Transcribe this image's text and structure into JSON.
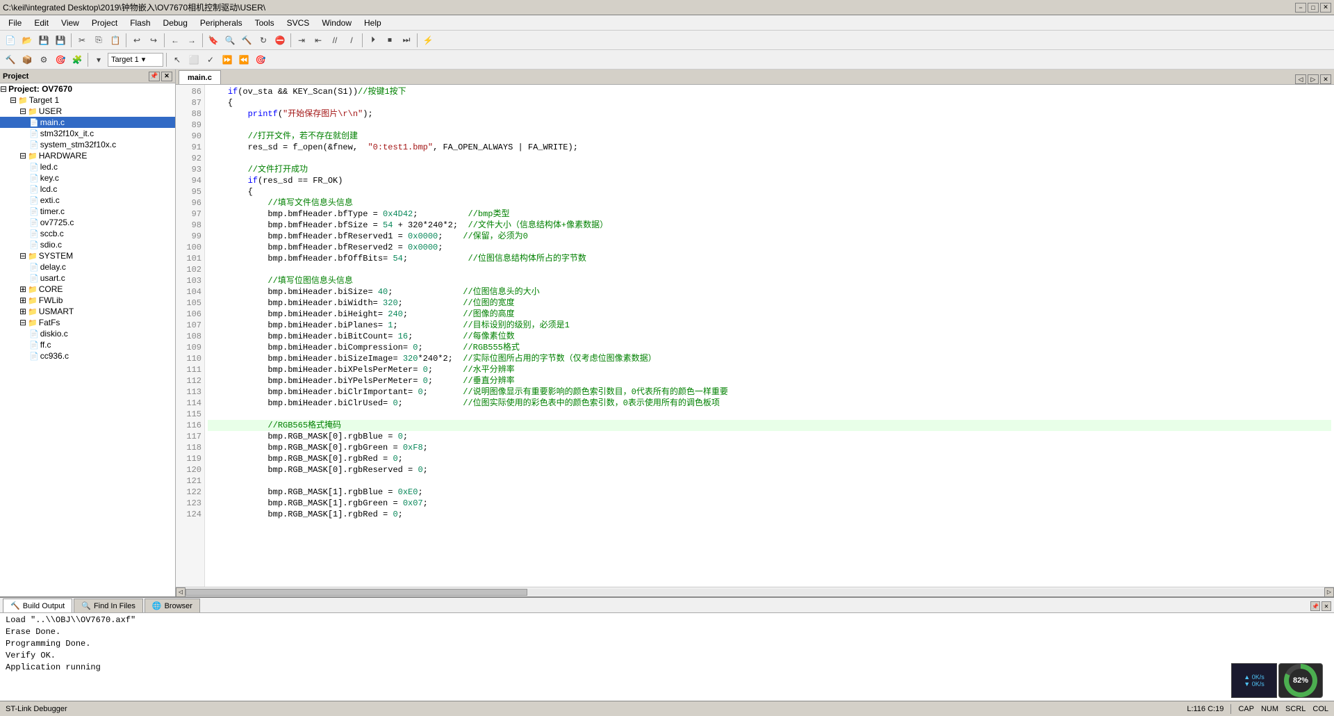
{
  "title_bar": {
    "text": "C:\\keil\\integrated Desktop\\2019\\钟物嵌入\\OV7670相机控制驱动\\USER\\",
    "minimize": "−",
    "maximize": "□",
    "close": "✕"
  },
  "menu": {
    "items": [
      "File",
      "Edit",
      "View",
      "Project",
      "Flash",
      "Debug",
      "Peripherals",
      "Tools",
      "SVCS",
      "Window",
      "Help"
    ]
  },
  "toolbar": {
    "target_dropdown": "Target 1"
  },
  "project_panel": {
    "title": "Project",
    "tree": [
      {
        "label": "Project: OV7670",
        "indent": 0,
        "type": "root",
        "expanded": true
      },
      {
        "label": "Target 1",
        "indent": 1,
        "type": "folder",
        "expanded": true
      },
      {
        "label": "USER",
        "indent": 2,
        "type": "folder",
        "expanded": true
      },
      {
        "label": "main.c",
        "indent": 3,
        "type": "file"
      },
      {
        "label": "stm32f10x_it.c",
        "indent": 3,
        "type": "file"
      },
      {
        "label": "system_stm32f10x.c",
        "indent": 3,
        "type": "file"
      },
      {
        "label": "HARDWARE",
        "indent": 2,
        "type": "folder",
        "expanded": true
      },
      {
        "label": "led.c",
        "indent": 3,
        "type": "file"
      },
      {
        "label": "key.c",
        "indent": 3,
        "type": "file"
      },
      {
        "label": "lcd.c",
        "indent": 3,
        "type": "file"
      },
      {
        "label": "exti.c",
        "indent": 3,
        "type": "file"
      },
      {
        "label": "timer.c",
        "indent": 3,
        "type": "file"
      },
      {
        "label": "ov7725.c",
        "indent": 3,
        "type": "file"
      },
      {
        "label": "sccb.c",
        "indent": 3,
        "type": "file"
      },
      {
        "label": "sdio.c",
        "indent": 3,
        "type": "file"
      },
      {
        "label": "SYSTEM",
        "indent": 2,
        "type": "folder",
        "expanded": true
      },
      {
        "label": "delay.c",
        "indent": 3,
        "type": "file"
      },
      {
        "label": "usart.c",
        "indent": 3,
        "type": "file"
      },
      {
        "label": "CORE",
        "indent": 2,
        "type": "folder",
        "expanded": false
      },
      {
        "label": "FWLib",
        "indent": 2,
        "type": "folder",
        "expanded": false
      },
      {
        "label": "USMART",
        "indent": 2,
        "type": "folder",
        "expanded": false
      },
      {
        "label": "FatFs",
        "indent": 2,
        "type": "folder",
        "expanded": true
      },
      {
        "label": "diskio.c",
        "indent": 3,
        "type": "file"
      },
      {
        "label": "ff.c",
        "indent": 3,
        "type": "file"
      },
      {
        "label": "cc936.c",
        "indent": 3,
        "type": "file"
      }
    ]
  },
  "editor": {
    "active_tab": "main.c",
    "lines": [
      {
        "num": 86,
        "content": "    if(ov_sta && KEY_Scan(S1))//按键1按下",
        "highlight": false
      },
      {
        "num": 87,
        "content": "    {",
        "highlight": false
      },
      {
        "num": 88,
        "content": "        printf(\"开始保存图片\\r\\n\");",
        "highlight": false
      },
      {
        "num": 89,
        "content": "",
        "highlight": false
      },
      {
        "num": 90,
        "content": "        //打开文件，若不存在就创建",
        "highlight": false
      },
      {
        "num": 91,
        "content": "        res_sd = f_open(&fnew,  \"0:test1.bmp\", FA_OPEN_ALWAYS | FA_WRITE);",
        "highlight": false
      },
      {
        "num": 92,
        "content": "",
        "highlight": false
      },
      {
        "num": 93,
        "content": "        //文件打开成功",
        "highlight": false
      },
      {
        "num": 94,
        "content": "        if(res_sd == FR_OK)",
        "highlight": false
      },
      {
        "num": 95,
        "content": "        {",
        "highlight": false
      },
      {
        "num": 96,
        "content": "            //填写文件信息头信息",
        "highlight": false
      },
      {
        "num": 97,
        "content": "            bmp.bmfHeader.bfType = 0x4D42;          //bmp类型",
        "highlight": false
      },
      {
        "num": 98,
        "content": "            bmp.bmfHeader.bfSize = 54 + 320*240*2;  //文件大小（信息结构体+像素数据）",
        "highlight": false
      },
      {
        "num": 99,
        "content": "            bmp.bmfHeader.bfReserved1 = 0x0000;    //保留，必须为0",
        "highlight": false
      },
      {
        "num": 100,
        "content": "            bmp.bmfHeader.bfReserved2 = 0x0000;",
        "highlight": false
      },
      {
        "num": 101,
        "content": "            bmp.bmfHeader.bfOffBits=54;            //位图信息结构体所占的字节数",
        "highlight": false
      },
      {
        "num": 102,
        "content": "",
        "highlight": false
      },
      {
        "num": 103,
        "content": "            //填写位图信息头信息",
        "highlight": false
      },
      {
        "num": 104,
        "content": "            bmp.bmiHeader.biSize=40;              //位图信息头的大小",
        "highlight": false
      },
      {
        "num": 105,
        "content": "            bmp.bmiHeader.biWidth=320;            //位图的宽度",
        "highlight": false
      },
      {
        "num": 106,
        "content": "            bmp.bmiHeader.biHeight=240;           //图像的高度",
        "highlight": false
      },
      {
        "num": 107,
        "content": "            bmp.bmiHeader.biPlanes=1;             //目标设别的级别，必须是1",
        "highlight": false
      },
      {
        "num": 108,
        "content": "            bmp.bmiHeader.biBitCount=16;          //每像素位数",
        "highlight": false
      },
      {
        "num": 109,
        "content": "            bmp.bmiHeader.biCompression=0;        //RGB555格式",
        "highlight": false
      },
      {
        "num": 110,
        "content": "            bmp.bmiHeader.biSizeImage=320*240*2;  //实际位图所占用的字节数（仅考虑位图像素数据）",
        "highlight": false
      },
      {
        "num": 111,
        "content": "            bmp.bmiHeader.biXPelsPerMeter=0;      //水平分辨率",
        "highlight": false
      },
      {
        "num": 112,
        "content": "            bmp.bmiHeader.biYPelsPerMeter=0;      //垂直分辨率",
        "highlight": false
      },
      {
        "num": 113,
        "content": "            bmp.bmiHeader.biClrImportant=0;       //说明图像显示有重要影响的颜色索引数目，0代表所有的颜色一样重要",
        "highlight": false
      },
      {
        "num": 114,
        "content": "            bmp.bmiHeader.biClrUsed=0;            //位图实际使用的彩色表中的颜色索引数，0表示使用所有的调色板项",
        "highlight": false
      },
      {
        "num": 115,
        "content": "",
        "highlight": false
      },
      {
        "num": 116,
        "content": "            //RGB565格式掩码",
        "highlight": true
      },
      {
        "num": 117,
        "content": "            bmp.RGB_MASK[0].rgbBlue = 0;",
        "highlight": false
      },
      {
        "num": 118,
        "content": "            bmp.RGB_MASK[0].rgbGreen = 0xF8;",
        "highlight": false
      },
      {
        "num": 119,
        "content": "            bmp.RGB_MASK[0].rgbRed = 0;",
        "highlight": false
      },
      {
        "num": 120,
        "content": "            bmp.RGB_MASK[0].rgbReserved = 0;",
        "highlight": false
      },
      {
        "num": 121,
        "content": "",
        "highlight": false
      },
      {
        "num": 122,
        "content": "            bmp.RGB_MASK[1].rgbBlue = 0xE0;",
        "highlight": false
      },
      {
        "num": 123,
        "content": "            bmp.RGB_MASK[1].rgbGreen = 0x07;",
        "highlight": false
      },
      {
        "num": 124,
        "content": "            bmp.RGB_MASK[1].rgbRed = 0;",
        "highlight": false
      }
    ]
  },
  "build_output": {
    "tabs": [
      {
        "label": "Build Output",
        "icon": "build-icon",
        "active": true
      },
      {
        "label": "Find In Files",
        "icon": "find-icon",
        "active": false
      },
      {
        "label": "Browser",
        "icon": "browser-icon",
        "active": false
      }
    ],
    "lines": [
      "Load \"..\\\\OBJ\\\\OV7670.axf\"",
      "Erase Done.",
      "Programming Done.",
      "Verify OK.",
      "Application running"
    ]
  },
  "status_bar": {
    "debugger": "ST-Link Debugger",
    "position": "L:116 C:19",
    "caps": "CAP",
    "num": "NUM",
    "scrl": "SCRL",
    "col": "COL"
  },
  "network": {
    "up": "0K/s",
    "down": "0K/s"
  },
  "battery": {
    "percent": "82%"
  },
  "icons": {
    "new_file": "📄",
    "open": "📂",
    "save": "💾",
    "cut": "✂",
    "copy": "📋",
    "paste": "📋",
    "undo": "↩",
    "redo": "↪",
    "back": "←",
    "forward": "→",
    "expand": "+",
    "collapse": "−",
    "pin": "📌",
    "close_small": "✕"
  }
}
